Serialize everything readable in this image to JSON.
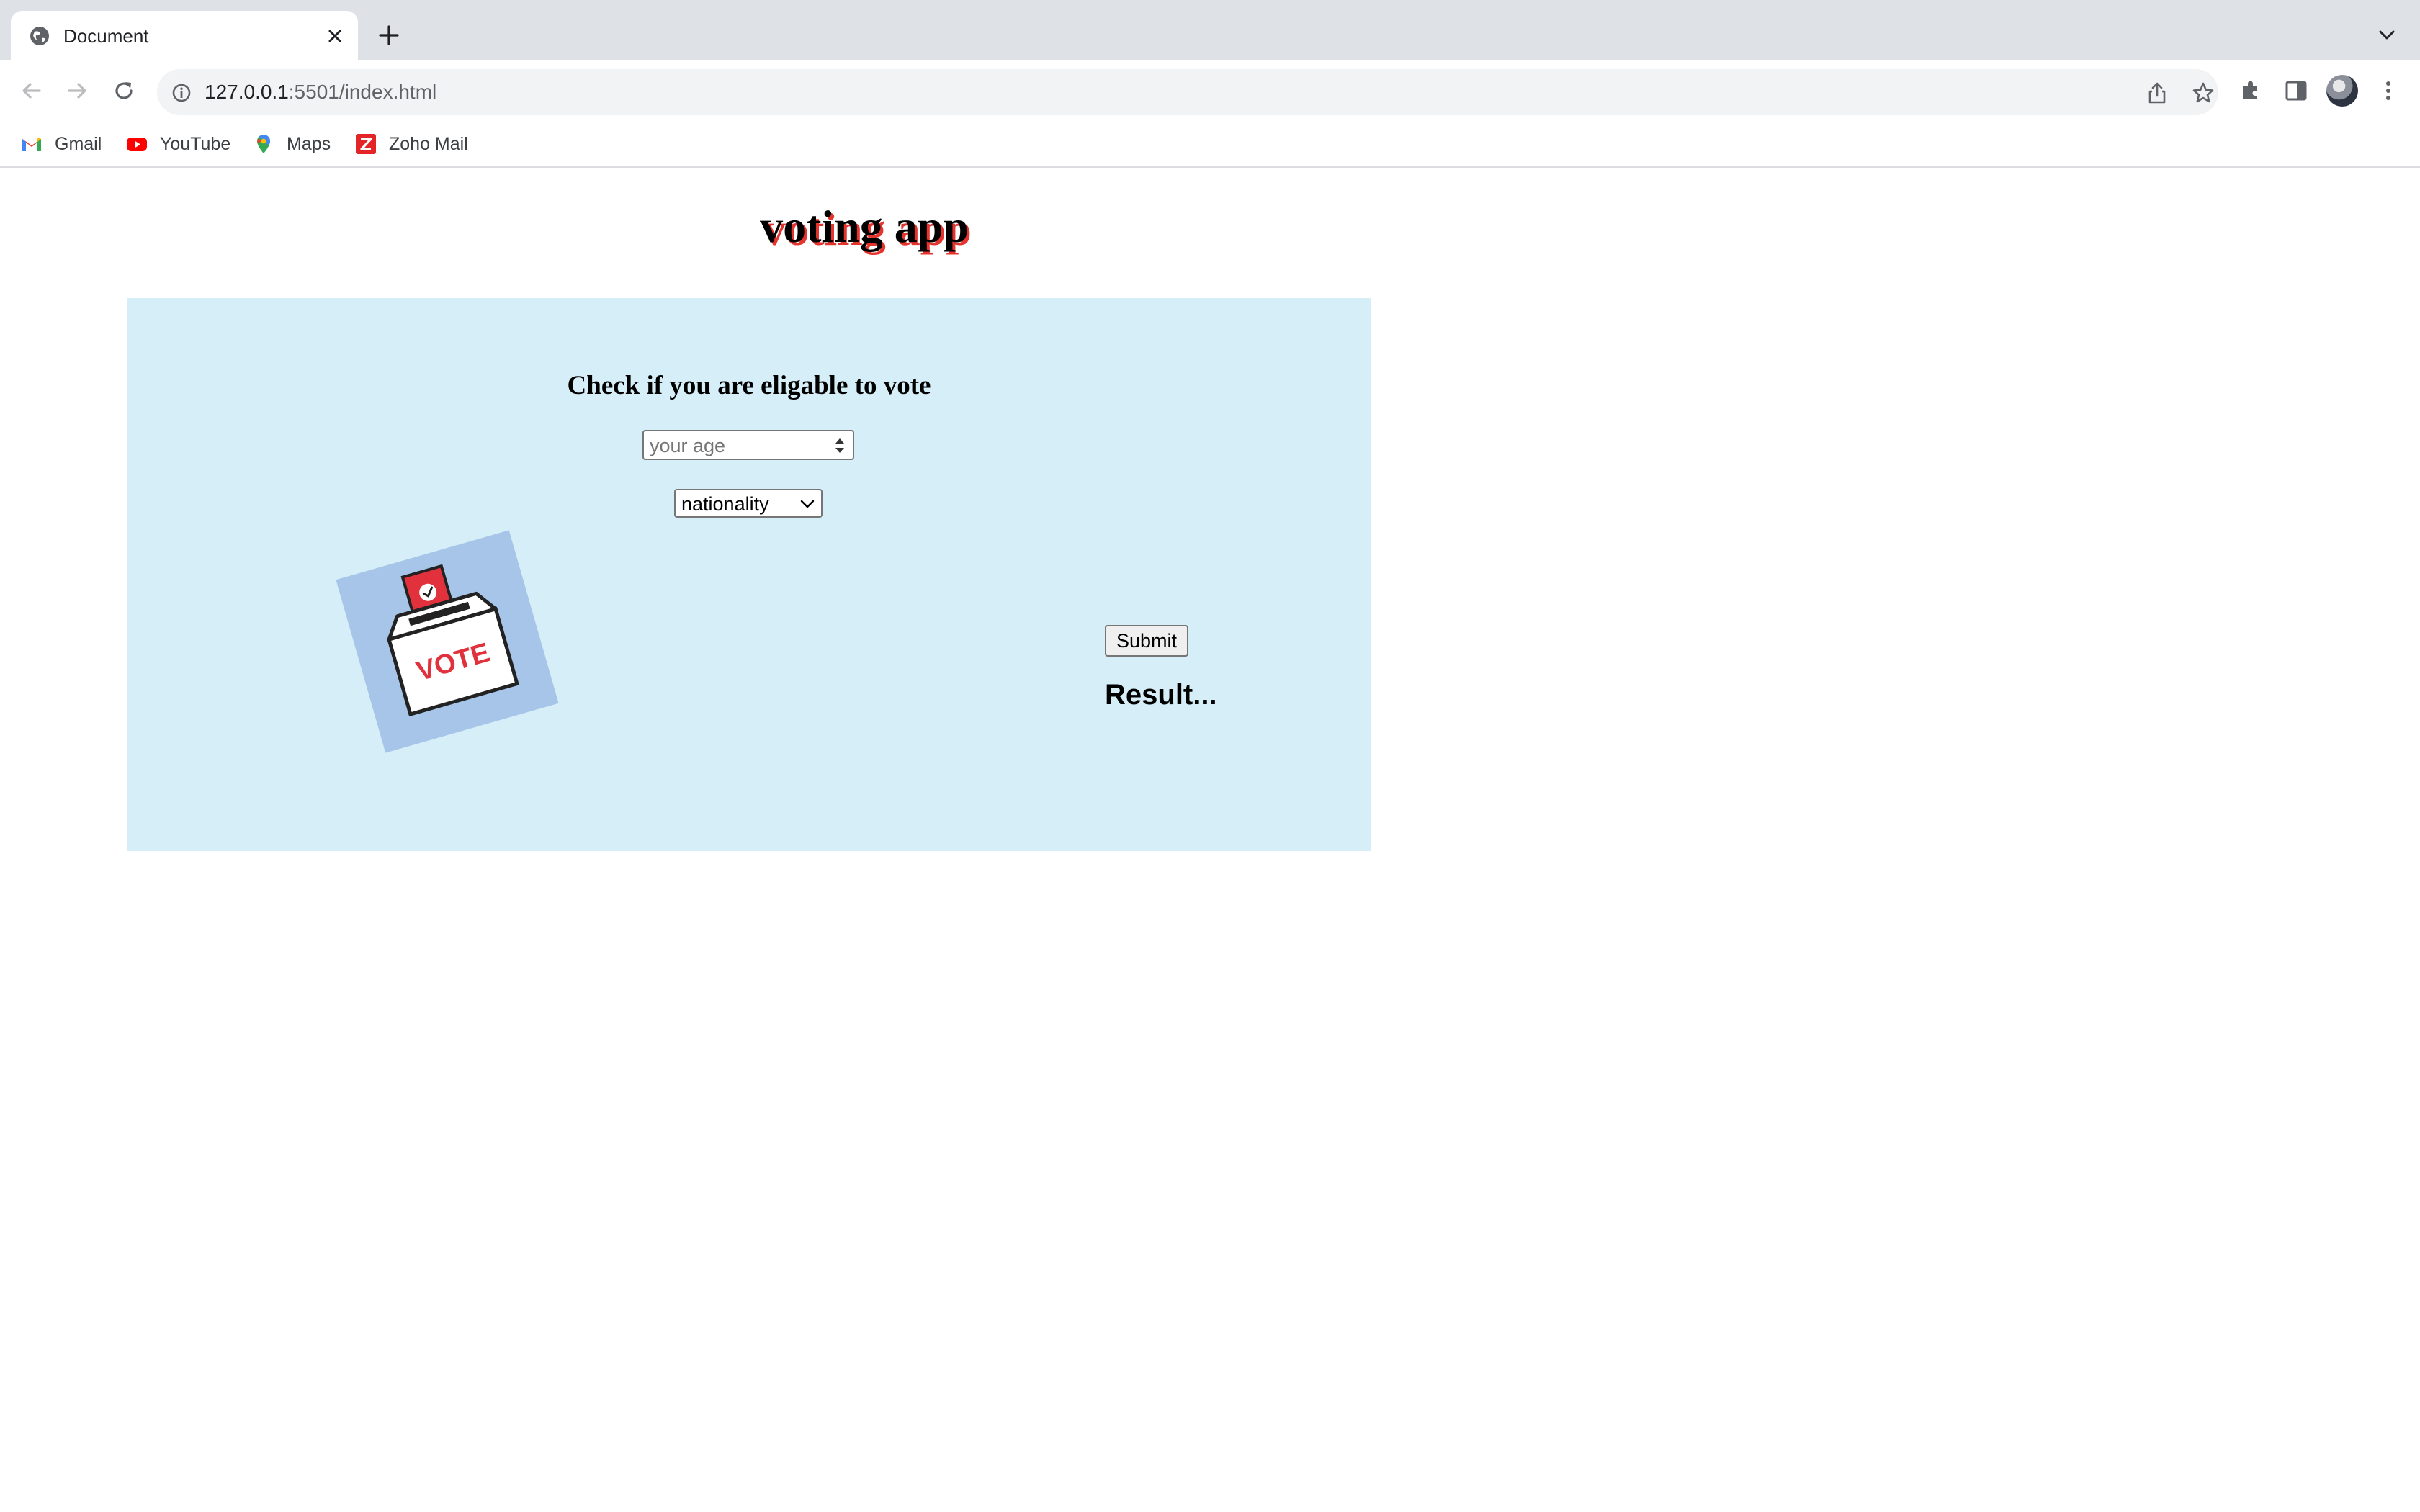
{
  "browser": {
    "tab": {
      "title": "Document",
      "favicon": "globe-icon"
    },
    "address_bar": {
      "host": "127.0.0.1",
      "path": ":5501/index.html"
    },
    "bookmarks": [
      {
        "label": "Gmail",
        "icon": "gmail-icon"
      },
      {
        "label": "YouTube",
        "icon": "youtube-icon"
      },
      {
        "label": "Maps",
        "icon": "maps-icon"
      },
      {
        "label": "Zoho Mail",
        "icon": "zoho-mail-icon"
      }
    ]
  },
  "page": {
    "title": "voting app",
    "form": {
      "heading": "Check if you are eligable to vote",
      "age_placeholder": "your age",
      "nationality_selected": "nationality",
      "illustration_text": "VOTE",
      "submit_label": "Submit",
      "result_text": "Result..."
    }
  },
  "colors": {
    "title_shadow": "#e5332e",
    "panel_background": "#d6eef8",
    "illustration_background": "#a6c5e8",
    "ballot_red": "#e0313c"
  }
}
